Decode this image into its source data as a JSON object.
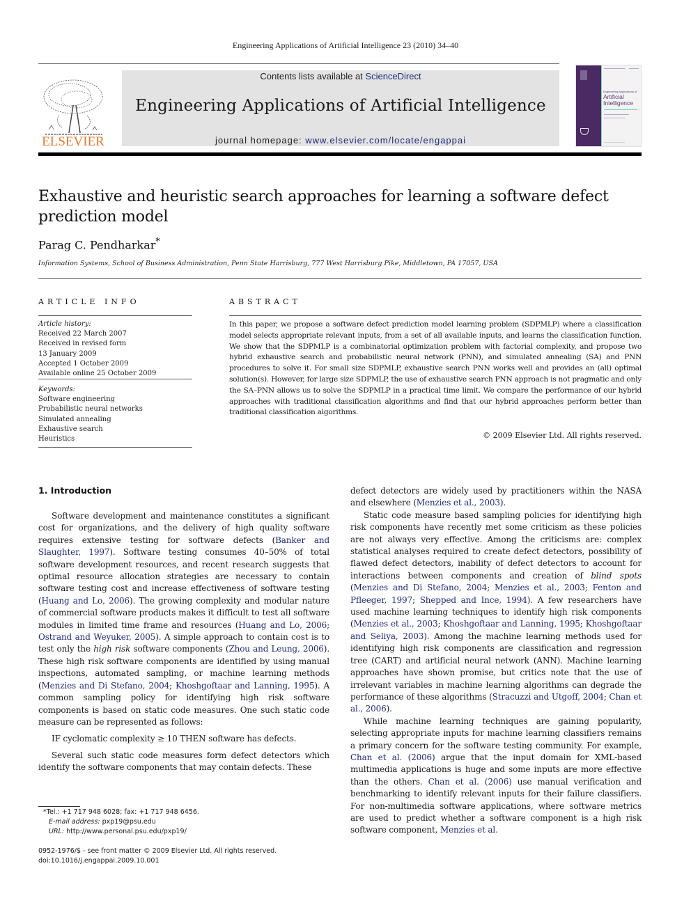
{
  "running_head": "Engineering Applications of Artificial Intelligence 23 (2010) 34–40",
  "masthead": {
    "publisher": "ELSEVIER",
    "contents_prefix": "Contents lists available at ",
    "contents_link": "ScienceDirect",
    "journal_title": "Engineering Applications of Artificial Intelligence",
    "homepage_prefix": "journal homepage: ",
    "homepage_link": "www.elsevier.com/locate/engappai",
    "cover": {
      "small_title": "Engineering Applications of",
      "title_line1": "Artificial",
      "title_line2": "Intelligence",
      "spine_color": "#4b2a63",
      "accent_color": "#7fd4c4"
    },
    "accent_orange": "#e8792a",
    "banner_gray": "#e3e3e3",
    "link_color": "#1f2a7a"
  },
  "article": {
    "title": "Exhaustive and heuristic search approaches for learning a software defect prediction model",
    "author": "Parag C. Pendharkar",
    "author_mark": "*",
    "affiliation": "Information Systems, School of Business Administration, Penn State Harrisburg, 777 West Harrisburg Pike, Middletown, PA 17057, USA"
  },
  "article_info": {
    "heading": "ARTICLE INFO",
    "history_label": "Article history:",
    "history": [
      "Received 22 March 2007",
      "Received in revised form",
      "13 January 2009",
      "Accepted 1 October 2009",
      "Available online 25 October 2009"
    ],
    "keywords_label": "Keywords:",
    "keywords": [
      "Software engineering",
      "Probabilistic neural networks",
      "Simulated annealing",
      "Exhaustive search",
      "Heuristics"
    ]
  },
  "abstract": {
    "heading": "ABSTRACT",
    "text": "In this paper, we propose a software defect prediction model learning problem (SDPMLP) where a classification model selects appropriate relevant inputs, from a set of all available inputs, and learns the classification function. We show that the SDPMLP is a combinatorial optimization problem with factorial complexity, and propose two hybrid exhaustive search and probabilistic neural network (PNN), and simulated annealing (SA) and PNN procedures to solve it. For small size SDPMLP, exhaustive search PNN works well and provides an (all) optimal solution(s). However, for large size SDPMLP, the use of exhaustive search PNN approach is not pragmatic and only the SA–PNN allows us to solve the SDPMLP in a practical time limit. We compare the performance of our hybrid approaches with traditional classification algorithms and find that our hybrid approaches perform better than traditional classification algorithms.",
    "copyright": "© 2009 Elsevier Ltd. All rights reserved."
  },
  "body": {
    "section_heading": "1.  Introduction",
    "left": {
      "p1": [
        {
          "t": "Software development and maintenance constitutes a significant cost for organizations, and the delivery of high quality software requires extensive testing for software defects ("
        },
        {
          "t": "Banker and Slaughter, 1997",
          "link": true
        },
        {
          "t": "). Software testing consumes 40–50% of total software development resources, and recent research suggests that optimal resource allocation strategies are necessary to contain software testing cost and increase effectiveness of software testing ("
        },
        {
          "t": "Huang and Lo, 2006",
          "link": true
        },
        {
          "t": "). The growing complexity and modular nature of commercial software products makes it difficult to test all software modules in limited time frame and resources ("
        },
        {
          "t": "Huang and Lo, 2006",
          "link": true
        },
        {
          "t": "; "
        },
        {
          "t": "Ostrand and Weyuker, 2005",
          "link": true
        },
        {
          "t": "). A simple approach to contain cost is to test only the "
        },
        {
          "t": "high risk",
          "italic": true
        },
        {
          "t": " software components ("
        },
        {
          "t": "Zhou and Leung, 2006",
          "link": true
        },
        {
          "t": "). These high risk software components are identified by using manual inspections, automated sampling, or machine learning methods ("
        },
        {
          "t": "Menzies and Di Stefano, 2004",
          "link": true
        },
        {
          "t": "; "
        },
        {
          "t": "Khoshgoftaar and Lanning, 1995",
          "link": true
        },
        {
          "t": "). A common sampling policy for identifying high risk software components is based on static code measures. One such static code measure can be represented as follows:"
        }
      ],
      "formula": "IF cyclomatic complexity ≥ 10 THEN software has defects.",
      "p2": [
        {
          "t": "Several such static code measures form defect detectors which identify the software components that may contain defects. These"
        }
      ]
    },
    "right": {
      "p1": [
        {
          "t": "defect detectors are widely used by practitioners within the NASA and elsewhere ("
        },
        {
          "t": "Menzies et al., 2003",
          "link": true
        },
        {
          "t": ")."
        }
      ],
      "p2": [
        {
          "t": "Static code measure based sampling policies for identifying high risk components have recently met some criticism as these policies are not always very effective. Among the criticisms are: complex statistical analyses required to create defect detectors, possibility of flawed defect detectors, inability of defect detectors to account for interactions between components and creation of "
        },
        {
          "t": "blind spots",
          "italic": true
        },
        {
          "t": " ("
        },
        {
          "t": "Menzies and Di Stefano, 2004",
          "link": true
        },
        {
          "t": "; "
        },
        {
          "t": "Menzies et al., 2003",
          "link": true
        },
        {
          "t": "; "
        },
        {
          "t": "Fenton and Pfleeger, 1997",
          "link": true
        },
        {
          "t": "; "
        },
        {
          "t": "Shepped and Ince, 1994",
          "link": true
        },
        {
          "t": "). A few researchers have used machine learning techniques to identify high risk components ("
        },
        {
          "t": "Menzies et al., 2003",
          "link": true
        },
        {
          "t": "; "
        },
        {
          "t": "Khoshgoftaar and Lanning, 1995",
          "link": true
        },
        {
          "t": "; "
        },
        {
          "t": "Khoshgoftaar and Seliya, 2003",
          "link": true
        },
        {
          "t": "). Among the machine learning methods used for identifying high risk components are classification and regression tree (CART) and artificial neural network (ANN). Machine learning approaches have shown promise, but critics note that the use of irrelevant variables in machine learning algorithms can degrade the performance of these algorithms ("
        },
        {
          "t": "Stracuzzi and Utgoff, 2004",
          "link": true
        },
        {
          "t": "; "
        },
        {
          "t": "Chan et al., 2006",
          "link": true
        },
        {
          "t": ")."
        }
      ],
      "p3": [
        {
          "t": "While machine learning techniques are gaining popularity, selecting appropriate inputs for machine learning classifiers remains a primary concern for the software testing community. For example, "
        },
        {
          "t": "Chan et al. (2006)",
          "link": true
        },
        {
          "t": " argue that the input domain for XML-based multimedia applications is huge and some inputs are more effective than the others. "
        },
        {
          "t": "Chan et al. (2006)",
          "link": true
        },
        {
          "t": " use manual verification and benchmarking to identify relevant inputs for their failure classifiers. For non-multimedia software applications, where software metrics are used to predict whether a software component is a high risk software component, "
        },
        {
          "t": "Menzies et al.",
          "link": true
        }
      ]
    }
  },
  "footnotes": {
    "tel": "*Tel.: +1 717 948 6028; fax: +1 717 948 6456.",
    "email_label": "E-mail address:",
    "email": " pxp19@psu.edu",
    "url_label": "URL:",
    "url": " http://www.personal.psu.edu/pxp19/",
    "issn": "0952-1976/$ - see front matter © 2009 Elsevier Ltd. All rights reserved.",
    "doi": "doi:10.1016/j.engappai.2009.10.001"
  }
}
